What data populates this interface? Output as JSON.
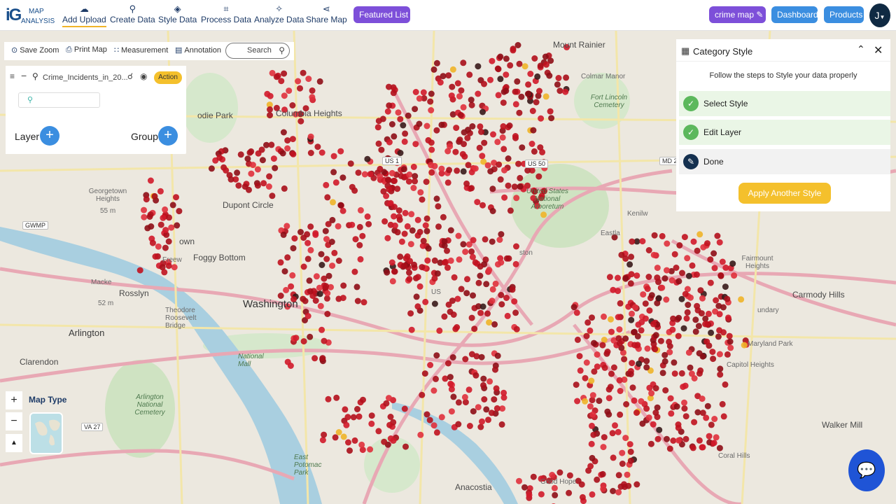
{
  "app": {
    "logo_top": "MAP",
    "logo_bottom": "ANALYSIS",
    "logo_mark": "iG"
  },
  "toolbar": {
    "items": [
      {
        "label": "Add Upload",
        "icon": "upload-cloud-icon",
        "glyph": "☁"
      },
      {
        "label": "Create Data",
        "icon": "map-pin-icon",
        "glyph": "⚲"
      },
      {
        "label": "Style Data",
        "icon": "paint-bucket-icon",
        "glyph": "◈"
      },
      {
        "label": "Process Data",
        "icon": "process-icon",
        "glyph": "⌗"
      },
      {
        "label": "Analyze Data",
        "icon": "analyze-icon",
        "glyph": "✧"
      },
      {
        "label": "Share Map",
        "icon": "share-icon",
        "glyph": "⋖"
      }
    ],
    "featured_list": "Featured List",
    "map_name": "crime map",
    "dashboard": "Dashboard",
    "products": "Products",
    "avatar_initial": "J"
  },
  "toolstrip": {
    "save_zoom": "Save Zoom",
    "print_map": "Print Map",
    "measurement": "Measurement",
    "annotation": "Annotation",
    "search_placeholder": "Search"
  },
  "layer_panel": {
    "layer_name": "Crime_Incidents_in_20...",
    "action": "Action",
    "layer_label": "Layer",
    "group_label": "Group"
  },
  "category_panel": {
    "title": "Category Style",
    "subtitle": "Follow the steps to Style your data properly",
    "steps": [
      {
        "label": "Select Style",
        "state": "complete"
      },
      {
        "label": "Edit Layer",
        "state": "complete"
      },
      {
        "label": "Done",
        "state": "current"
      }
    ],
    "apply_button": "Apply Another Style"
  },
  "map_controls": {
    "zoom_in": "+",
    "zoom_out": "−",
    "north": "▲",
    "map_type_label": "Map Type"
  },
  "map_labels": {
    "washington": "Washington",
    "arlington": "Arlington",
    "rosslyn": "Rosslyn",
    "clarendon": "Clarendon",
    "dupont": "Dupont Circle",
    "foggy": "Foggy Bottom",
    "georgetown": "Georgetown Heights",
    "georgetown_elev": "55 m",
    "columbia": "Columbia Heights",
    "mount_rainier": "Mount Rainier",
    "colmar": "Colmar Manor",
    "fort_lincoln": "Fort Lincoln Cemetery",
    "fairmount": "Fairmount Heights",
    "carmody": "Carmody Hills",
    "maryland_park": "Maryland Park",
    "capitol_heights": "Capitol Heights",
    "walker_mill": "Walker Mill",
    "coral_hills": "Coral Hills",
    "anacostia": "Anacostia",
    "good_hope": "Good Hope",
    "theodore": "Theodore Roosevelt Bridge",
    "national_mall": "National Mall",
    "arlington_cemetery": "Arlington National Cemetery",
    "national_arboretum": "United States National Arboretum",
    "east_potomac": "East Potomac Park",
    "kenilworth": "Kenilw",
    "eastland": "Eastla",
    "mackey": "Macke",
    "elev_52": "52 m",
    "gwmp": "GWMP",
    "us1": "US 1",
    "us50": "US 50",
    "md2": "MD 2",
    "va27": "VA 27",
    "sundary": "undary",
    "town": "own",
    "freeway": "Freew",
    "ston": "ston",
    "us": "US",
    "park": "odie Park"
  },
  "colors": {
    "brand_navy": "#1e3b67",
    "accent_purple": "#7d4fd9",
    "accent_blue": "#3b8ee0",
    "accent_yellow": "#f4c02c",
    "crime_point": "#c1121f",
    "step_green": "#5cb85c"
  }
}
